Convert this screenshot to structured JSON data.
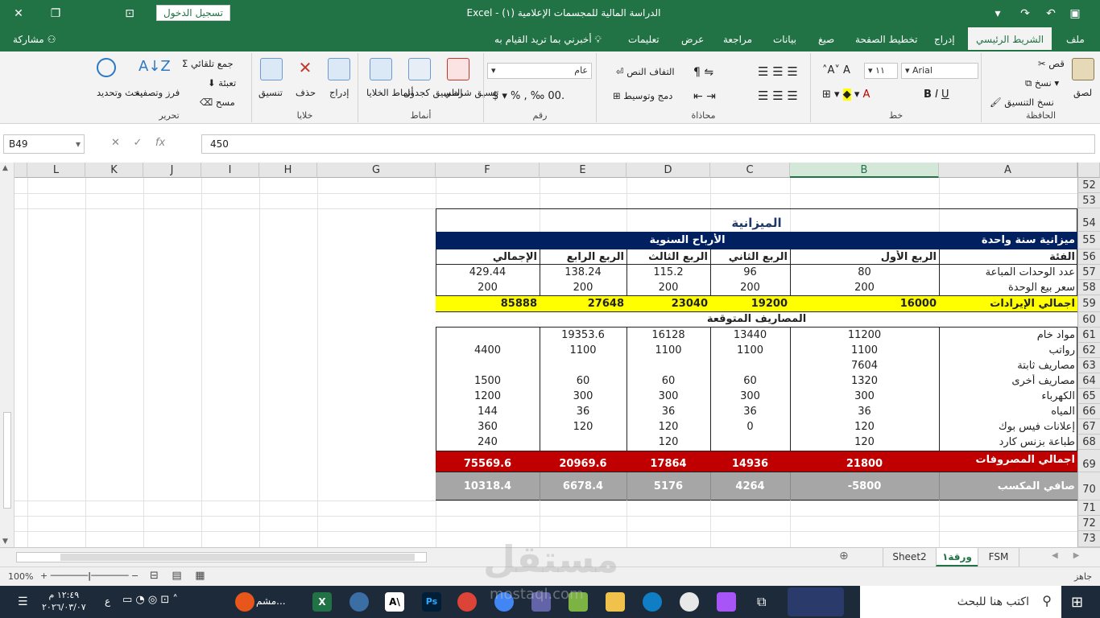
{
  "title_bar": {
    "doc_title": "الدراسة المالية للمجسمات الإعلامية (١)  -  Excel",
    "sign_in": "تسجيل الدخول"
  },
  "ribbon_tabs": {
    "file": "ملف",
    "home": "الشريط الرئيسي",
    "insert": "إدراج",
    "page_layout": "تخطيط الصفحة",
    "formulas": "صيغ",
    "data": "بيانات",
    "review": "مراجعة",
    "view": "عرض",
    "help": "تعليمات",
    "tell_me": "أخبرني بما تريد القيام به",
    "share": "مشاركة"
  },
  "ribbon": {
    "clipboard": {
      "label": "الحافظة",
      "paste": "لصق",
      "cut": "قص",
      "copy": "نسخ",
      "format_painter": "نسخ التنسيق"
    },
    "font": {
      "label": "خط",
      "font_name": "Arial",
      "font_size": "١١"
    },
    "alignment": {
      "label": "محاذاة",
      "wrap": "التفاف النص",
      "merge": "دمج وتوسيط"
    },
    "number": {
      "label": "رقم",
      "format": "عام"
    },
    "styles": {
      "label": "أنماط",
      "conditional": "تنسيق شرطي",
      "table": "التنسيق كجدول",
      "cell_styles": "أنماط الخلايا"
    },
    "cells": {
      "label": "خلايا",
      "insert": "إدراج",
      "delete": "حذف",
      "format": "تنسيق"
    },
    "editing": {
      "label": "تحرير",
      "autosum": "جمع تلقائي",
      "fill": "تعبئة",
      "clear": "مسح",
      "sort": "فرز وتصفية",
      "find": "بحث وتحديد"
    }
  },
  "formula_bar": {
    "name_box": "B49",
    "formula": "450"
  },
  "columns": [
    "A",
    "B",
    "C",
    "D",
    "E",
    "F",
    "G",
    "H",
    "I",
    "J",
    "K",
    "L"
  ],
  "rows": [
    "52",
    "53",
    "54",
    "55",
    "56",
    "57",
    "58",
    "59",
    "60",
    "61",
    "62",
    "63",
    "64",
    "65",
    "66",
    "67",
    "68",
    "69",
    "70",
    "71",
    "72",
    "73"
  ],
  "sheet": {
    "title": "الميزانية",
    "header_a": "ميزانية سنة واحدة",
    "header_profit": "الأرباح السنوية",
    "cat": "الفئة",
    "q1": "الربع الأول",
    "q2": "الربع الثاني",
    "q3": "الربع الثالث",
    "q4": "الربع الرابع",
    "total": "الإجمالي",
    "r57": [
      "عدد الوحدات المباعة",
      "80",
      "96",
      "115.2",
      "138.24",
      "429.44"
    ],
    "r58": [
      "سعر بيع الوحدة",
      "200",
      "200",
      "200",
      "200",
      "200"
    ],
    "r59": [
      "اجمالي الإيرادات",
      "16000",
      "19200",
      "23040",
      "27648",
      "85888"
    ],
    "expenses": "المصاريف المتوقعة",
    "r61": [
      "مواد خام",
      "11200",
      "13440",
      "16128",
      "19353.6",
      ""
    ],
    "r62": [
      "رواتب",
      "1100",
      "1100",
      "1100",
      "1100",
      "4400"
    ],
    "r63": [
      "مصاريف ثابتة",
      "7604",
      "",
      "",
      "",
      ""
    ],
    "r64": [
      "مصاريف أخرى",
      "1320",
      "60",
      "60",
      "60",
      "1500"
    ],
    "r65": [
      "الكهرباء",
      "300",
      "300",
      "300",
      "300",
      "1200"
    ],
    "r66": [
      "المياه",
      "36",
      "36",
      "36",
      "36",
      "144"
    ],
    "r67": [
      "إعلانات فيس بوك",
      "120",
      "0",
      "120",
      "120",
      "360"
    ],
    "r68": [
      "طباعة بزنس كارد",
      "120",
      "",
      "120",
      "",
      "240"
    ],
    "r69": [
      "اجمالي المصروفات",
      "21800",
      "14936",
      "17864",
      "20969.6",
      "75569.6"
    ],
    "r70": [
      "صافي المكسب",
      "-5800",
      "4264",
      "5176",
      "6678.4",
      "10318.4"
    ]
  },
  "sheet_tabs": [
    "FSM",
    "ورقة١",
    "Sheet2"
  ],
  "status": {
    "ready": "جاهز",
    "zoom": "100%"
  },
  "taskbar": {
    "search": "اكتب هنا للبحث",
    "time": "١٢:٤٩ م",
    "date": "٢٠٢٦/٠٣/٠٧",
    "lang": "ع",
    "app_label": "مشم..."
  },
  "watermark": {
    "ar": "مستقل",
    "en": "mostaql.com"
  },
  "colors": {
    "excel_green": "#217346",
    "header_navy": "#002060",
    "revenue_yellow": "#ffff00",
    "expense_red": "#c00000",
    "net_gray": "#a6a6a6"
  }
}
